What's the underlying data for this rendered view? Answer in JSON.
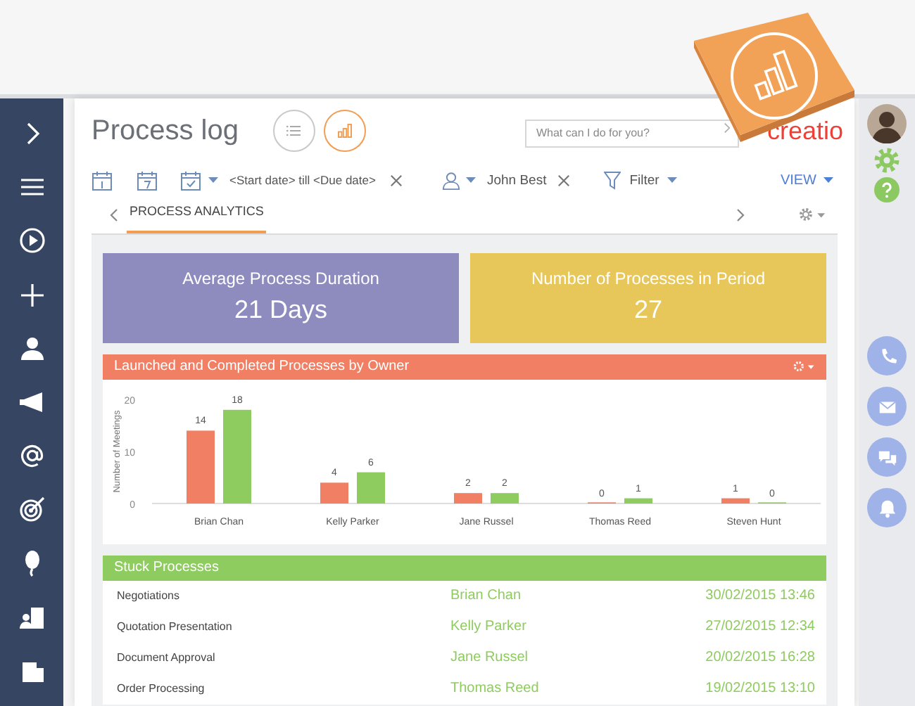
{
  "header": {
    "title": "Process log",
    "view_buttons": [
      {
        "selected": false
      },
      {
        "selected": true
      }
    ],
    "search": {
      "placeholder": "What can I do for you?"
    },
    "logo": "creatio"
  },
  "toolbar": {
    "date_filter": "<Start date> till <Due date>",
    "owner_filter": "John Best",
    "filter": "Filter",
    "view": "VIEW"
  },
  "tabs": [
    {
      "label": "PROCESS ANALYTICS",
      "selected": true
    }
  ],
  "metrics": [
    {
      "title": "Average Process Duration",
      "value": "21 Days",
      "color": "#8e8bbf"
    },
    {
      "title": "Number of Processes in Period",
      "value": "27",
      "color": "#e8c75a"
    }
  ],
  "chart_panel": {
    "title": "Launched and Completed Processes by Owner",
    "chart_data": {
      "type": "bar",
      "ylabel": "Number of Meetings",
      "categories": [
        "Brian Chan",
        "Kelly Parker",
        "Jane Russel",
        "Thomas Reed",
        "Steven Hunt"
      ],
      "series": [
        {
          "color": "#f07f63",
          "values": [
            14,
            4,
            2,
            0,
            1
          ]
        },
        {
          "color": "#8fcc5f",
          "values": [
            18,
            6,
            2,
            1,
            0
          ]
        }
      ],
      "ylim": [
        0,
        20
      ],
      "yticks": [
        0,
        10,
        20
      ],
      "data_labels": true
    }
  },
  "stuck_panel": {
    "title": "Stuck Processes",
    "rows": [
      {
        "process": "Negotiations",
        "owner": "Brian Chan",
        "date": "30/02/2015 13:46"
      },
      {
        "process": "Quotation Presentation",
        "owner": "Kelly Parker",
        "date": "27/02/2015 12:34"
      },
      {
        "process": "Document Approval",
        "owner": "Jane Russel",
        "date": "20/02/2015 16:28"
      },
      {
        "process": "Order Processing",
        "owner": "Thomas Reed",
        "date": "19/02/2015 13:10"
      }
    ]
  }
}
